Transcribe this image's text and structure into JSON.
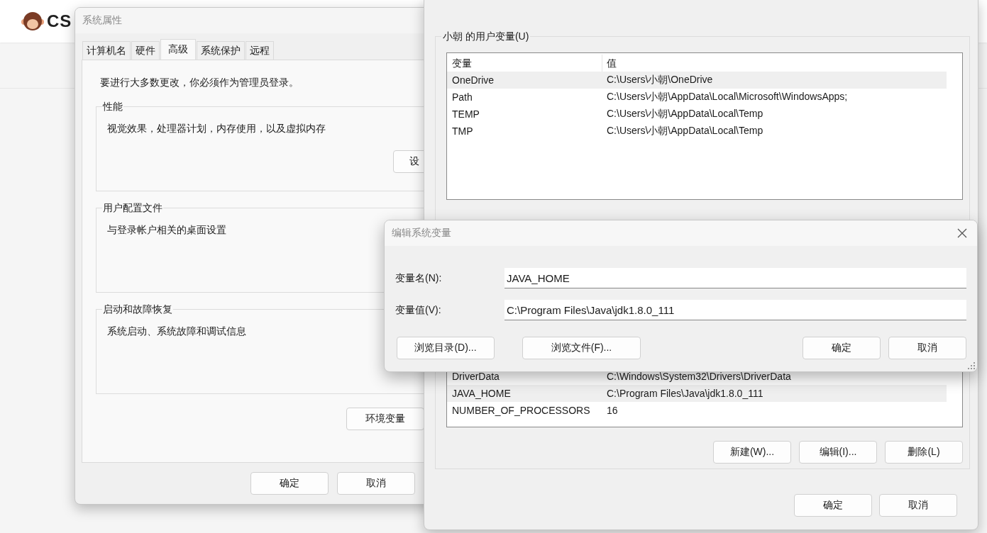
{
  "site_header": {
    "logo_text": "CS"
  },
  "system_properties": {
    "title": "系统属性",
    "tabs": [
      {
        "label": "计算机名",
        "selected": false
      },
      {
        "label": "硬件",
        "selected": false
      },
      {
        "label": "高级",
        "selected": true
      },
      {
        "label": "系统保护",
        "selected": false
      },
      {
        "label": "远程",
        "selected": false
      }
    ],
    "admin_note": "要进行大多数更改，你必须作为管理员登录。",
    "groups": [
      {
        "title": "性能",
        "description": "视觉效果，处理器计划，内存使用，以及虚拟内存",
        "button": "设"
      },
      {
        "title": "用户配置文件",
        "description": "与登录帐户相关的桌面设置"
      },
      {
        "title": "启动和故障恢复",
        "description": "系统启动、系统故障和调试信息"
      }
    ],
    "env_button": "环境变量",
    "buttons": [
      "确定",
      "取消"
    ]
  },
  "environment_variables": {
    "user_group_title": "小朝 的用户变量(U)",
    "columns": [
      "变量",
      "值"
    ],
    "user_rows": [
      {
        "name": "OneDrive",
        "value": "C:\\Users\\小朝\\OneDrive",
        "selected": true
      },
      {
        "name": "Path",
        "value": "C:\\Users\\小朝\\AppData\\Local\\Microsoft\\WindowsApps;",
        "selected": false
      },
      {
        "name": "TEMP",
        "value": "C:\\Users\\小朝\\AppData\\Local\\Temp",
        "selected": false
      },
      {
        "name": "TMP",
        "value": "C:\\Users\\小朝\\AppData\\Local\\Temp",
        "selected": false
      }
    ],
    "system_rows": [
      {
        "name": "DriverData",
        "value": "C:\\Windows\\System32\\Drivers\\DriverData",
        "selected": false
      },
      {
        "name": "JAVA_HOME",
        "value": "C:\\Program Files\\Java\\jdk1.8.0_111",
        "selected": true
      },
      {
        "name": "NUMBER_OF_PROCESSORS",
        "value": "16",
        "selected": false
      }
    ],
    "system_buttons": [
      "新建(W)...",
      "编辑(I)...",
      "删除(L)"
    ],
    "buttons": [
      "确定",
      "取消"
    ]
  },
  "edit_dialog": {
    "title": "编辑系统变量",
    "fields": [
      {
        "label": "变量名(N):",
        "value": "JAVA_HOME"
      },
      {
        "label": "变量值(V):",
        "value": "C:\\Program Files\\Java\\jdk1.8.0_111"
      }
    ],
    "browse_buttons": [
      "浏览目录(D)...",
      "浏览文件(F)..."
    ],
    "buttons": [
      "确定",
      "取消"
    ]
  }
}
